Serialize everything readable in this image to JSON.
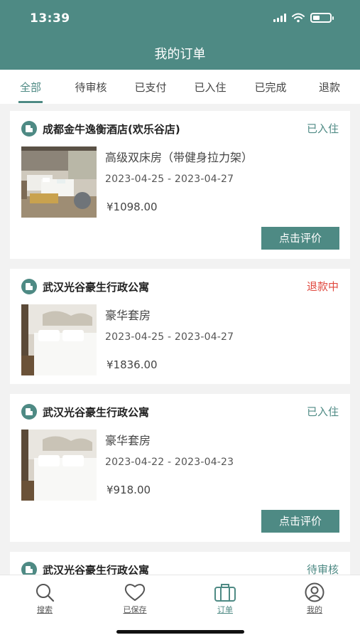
{
  "status_bar": {
    "time": "13:39"
  },
  "header": {
    "title": "我的订单"
  },
  "tabs": [
    {
      "label": "全部",
      "active": true
    },
    {
      "label": "待审核",
      "active": false
    },
    {
      "label": "已支付",
      "active": false
    },
    {
      "label": "已入住",
      "active": false
    },
    {
      "label": "已完成",
      "active": false
    },
    {
      "label": "退款",
      "active": false
    }
  ],
  "orders": [
    {
      "hotel": "成都金牛逸衡酒店(欢乐谷店)",
      "status": "已入住",
      "room": "高级双床房（带健身拉力架）",
      "dates": "2023-04-25 - 2023-04-27",
      "price": "¥1098.00",
      "action": "点击评价"
    },
    {
      "hotel": "武汉光谷豪生行政公寓",
      "status": "退款中",
      "room": "豪华套房",
      "dates": "2023-04-25 - 2023-04-27",
      "price": "¥1836.00",
      "action": ""
    },
    {
      "hotel": "武汉光谷豪生行政公寓",
      "status": "已入住",
      "room": "豪华套房",
      "dates": "2023-04-22 - 2023-04-23",
      "price": "¥918.00",
      "action": "点击评价"
    },
    {
      "hotel": "武汉光谷豪生行政公寓",
      "status": "待审核"
    }
  ],
  "bottom_nav": [
    {
      "label": "搜索",
      "icon": "search-icon",
      "active": false
    },
    {
      "label": "已保存",
      "icon": "heart-icon",
      "active": false
    },
    {
      "label": "订单",
      "icon": "suitcase-icon",
      "active": true
    },
    {
      "label": "我的",
      "icon": "user-icon",
      "active": false
    }
  ],
  "colors": {
    "primary": "#4e8a84",
    "refund": "#e0483e",
    "background": "#f2f2f2"
  }
}
